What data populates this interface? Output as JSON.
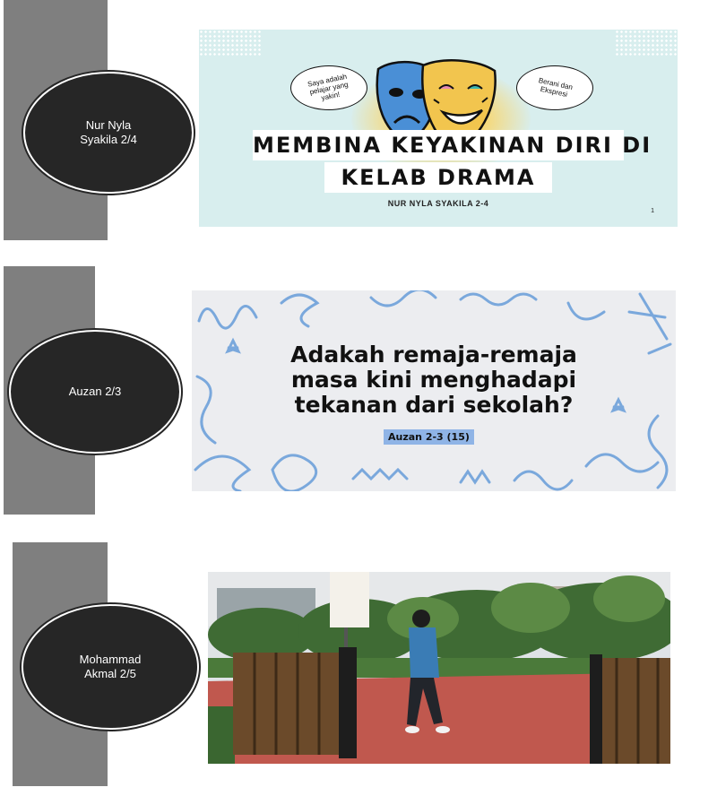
{
  "rows": [
    {
      "student": "Nur Nyla\nSyakila 2/4",
      "slide": {
        "bubble_left": "Saya adalah pelajar yang yakin!",
        "bubble_right": "Berani dan Ekspresi",
        "title_line1": "MEMBINA KEYAKINAN DIRI DI",
        "title_line2": "KELAB DRAMA",
        "author": "NUR NYLA SYAKILA 2-4",
        "page_number": "1"
      }
    },
    {
      "student": "Auzan 2/3",
      "slide": {
        "question_line1": "Adakah remaja-remaja",
        "question_line2": "masa kini menghadapi",
        "question_line3": "tekanan dari sekolah?",
        "tag": "Auzan 2-3 (15)"
      }
    },
    {
      "student": "Mohammad\nAkmal 2/5",
      "photo": "video-frame-boy-running-garden"
    }
  ],
  "colors": {
    "sidebar_bar": "#7f7f7f",
    "name_oval": "#262626",
    "slide1_bg": "#d8eeee",
    "slide2_bg": "#ecedf0",
    "slide2_doodle": "#7aa8dc",
    "tag_bg": "#8fb4e6"
  }
}
